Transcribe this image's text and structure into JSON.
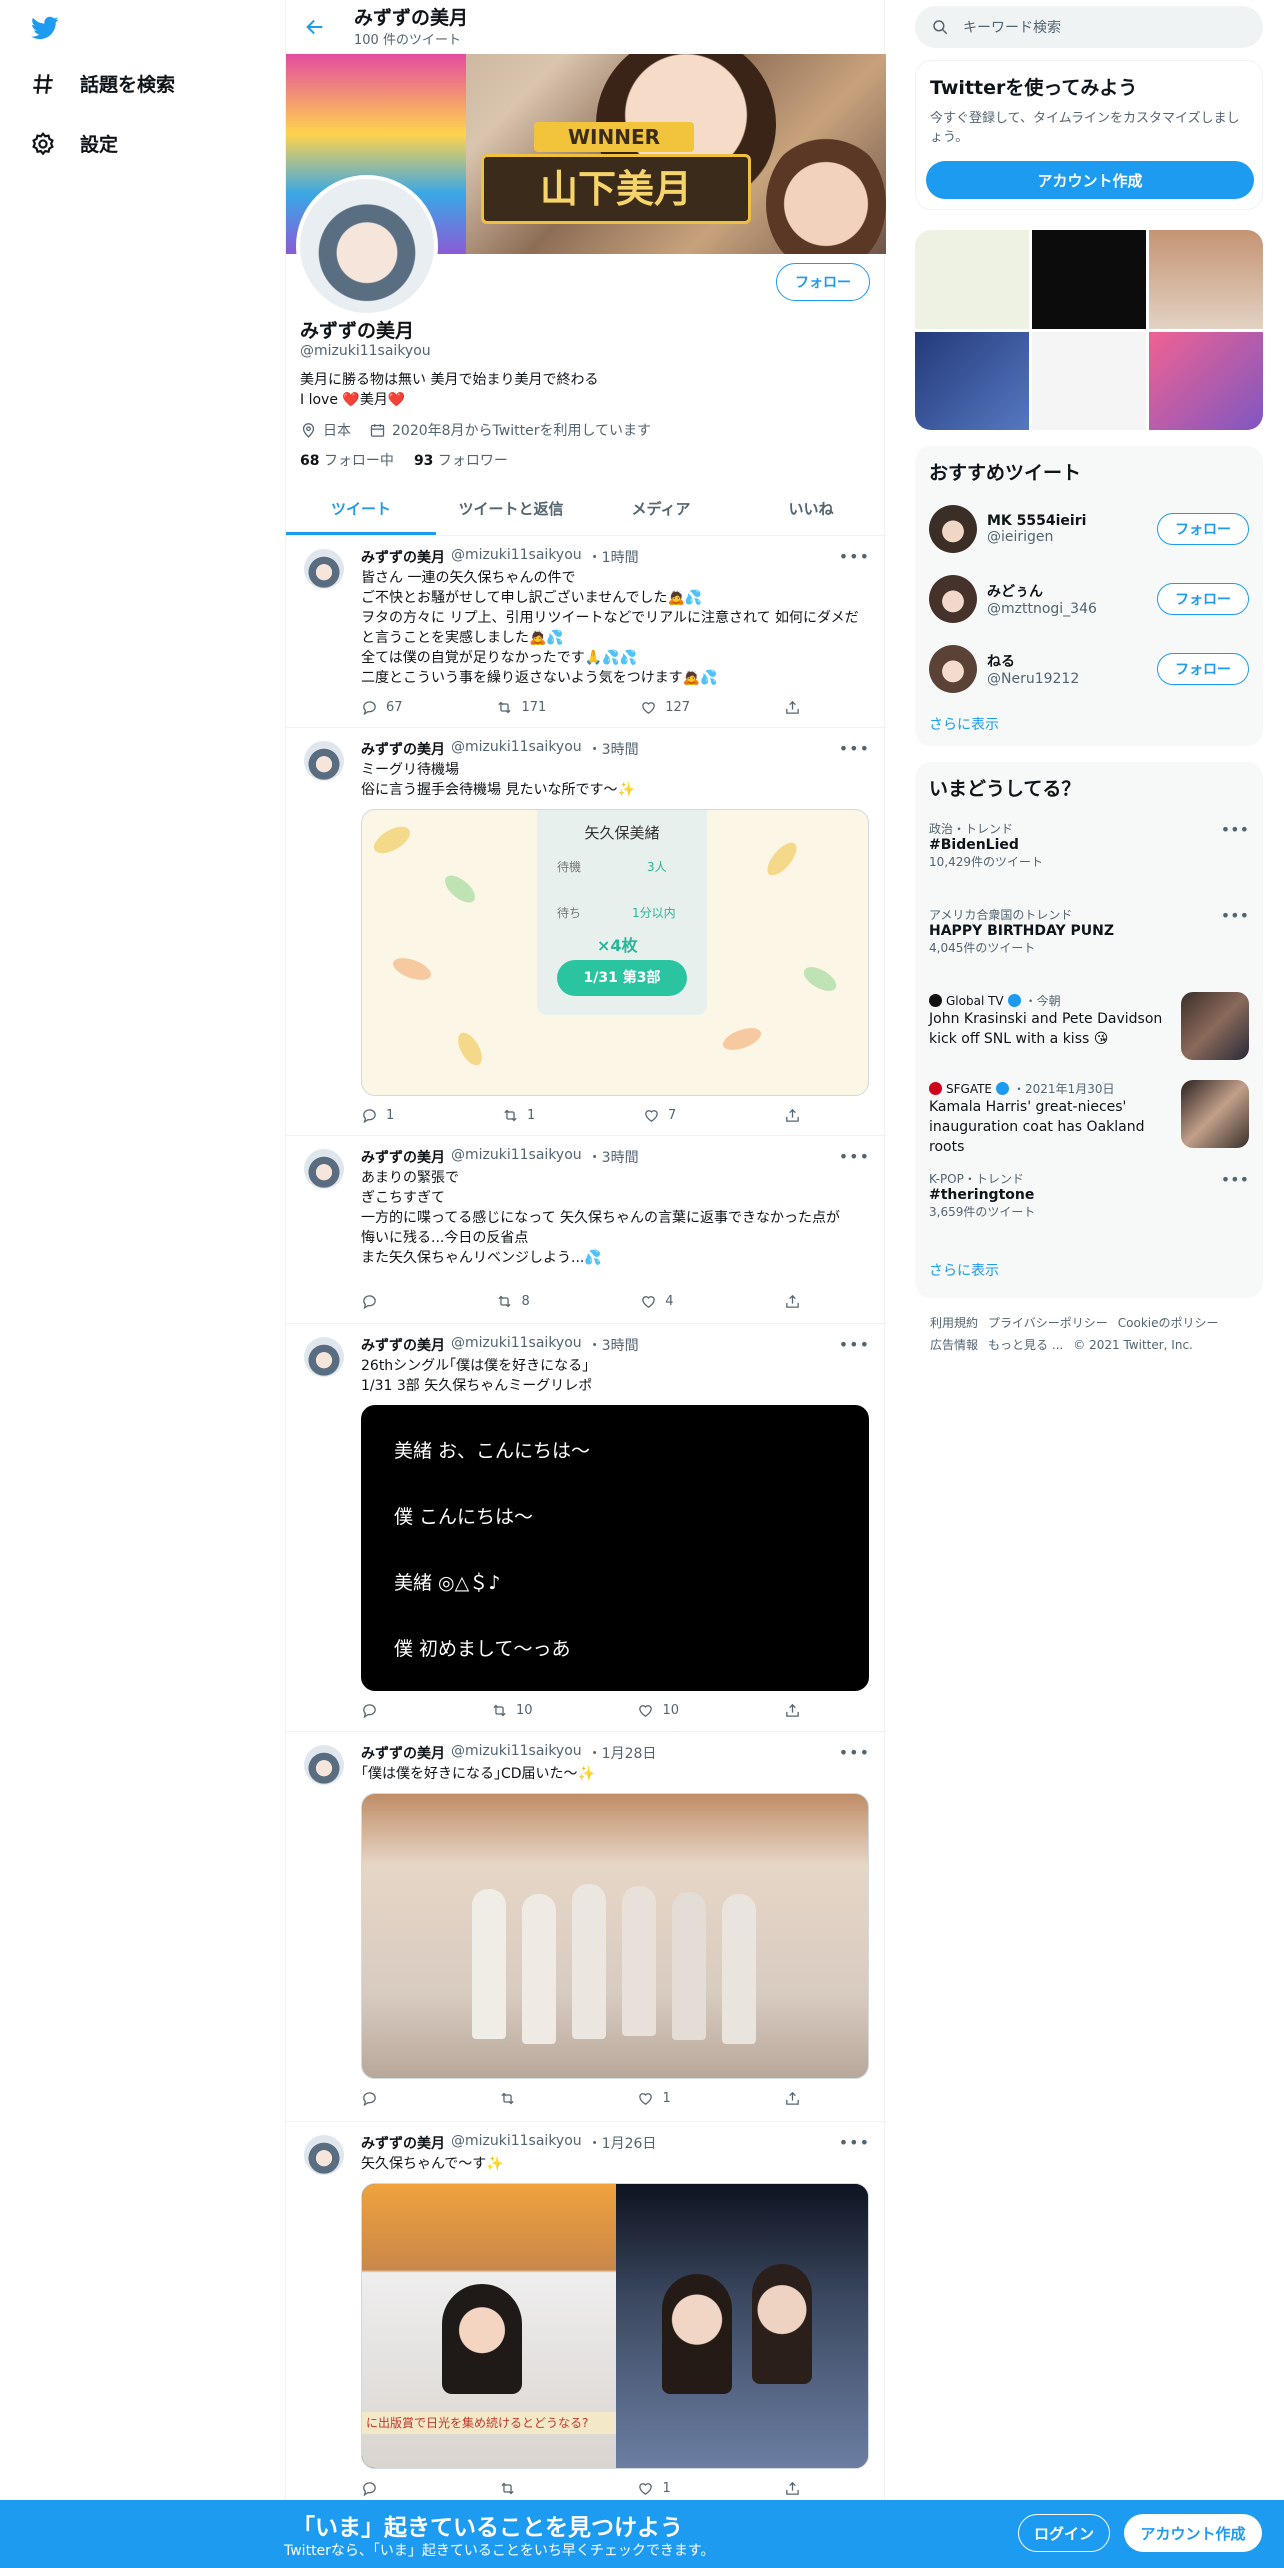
{
  "nav": {
    "explore_label": "話題を検索",
    "settings_label": "設定"
  },
  "topbar": {
    "title": "みずずの美月",
    "tweet_count": "100 件のツイート"
  },
  "banner": {
    "winner": "WINNER",
    "name_plate": "山下美月"
  },
  "profile": {
    "follow_label": "フォロー",
    "name": "みずずの美月",
    "handle": "@mizuki11saikyou",
    "bio_line1": "美月に勝る物は無い 美月で始まり美月で終わる",
    "bio_line2": "I love ❤️美月❤️",
    "location": "日本",
    "joined": "2020年8月からTwitterを利用しています",
    "following_count": "68",
    "following_label": "フォロー中",
    "followers_count": "93",
    "followers_label": "フォロワー"
  },
  "tabs": [
    "ツイート",
    "ツイートと返信",
    "メディア",
    "いいね"
  ],
  "tweets": [
    {
      "name": "みずずの美月",
      "handle": "@mizuki11saikyou",
      "time": "・1時間",
      "text": "皆さん 一連の矢久保ちゃんの件で\nご不快とお騒がせして申し訳ございませんでした🙇💦\nヲタの方々に リプ上、引用リツイートなどでリアルに注意されて 如何にダメだと言うことを実感しました🙇💦\n全ては僕の自覚が足りなかったです🙏💦💦\n二度とこういう事を繰り返さないよう気をつけます🙇💦",
      "reply": "67",
      "retweet": "171",
      "like": "127"
    },
    {
      "name": "みずずの美月",
      "handle": "@mizuki11saikyou",
      "time": "・3時間",
      "text": "ミーグリ待機場\n俗に言う握手会待機場 見たいな所です〜✨",
      "reply": "1",
      "retweet": "1",
      "like": "7",
      "card": {
        "title": "矢久保美緒",
        "wait_label": "待機",
        "wait_value": "3人",
        "time_label": "待ち",
        "time_value": "1分以内",
        "tickets": "×4枚",
        "session": "1/31 第3部"
      }
    },
    {
      "name": "みずずの美月",
      "handle": "@mizuki11saikyou",
      "time": "・3時間",
      "text": "あまりの緊張で\nぎこちすぎて\n一方的に喋ってる感じになって 矢久保ちゃんの言葉に返事できなかった点が\n悔いに残る...今日の反省点\nまた矢久保ちゃんリベンジしよう...💦",
      "reply": "",
      "retweet": "8",
      "like": "4"
    },
    {
      "name": "みずずの美月",
      "handle": "@mizuki11saikyou",
      "time": "・3時間",
      "text": "26thシングル｢僕は僕を好きになる｣\n1/31 3部 矢久保ちゃんミーグリレポ",
      "reply": "",
      "retweet": "10",
      "like": "10",
      "chat": [
        "美緒 お、こんにちは〜",
        "僕 こんにちは〜",
        "美緒 ◎△＄♪",
        "僕 初めまして〜っあ"
      ]
    },
    {
      "name": "みずずの美月",
      "handle": "@mizuki11saikyou",
      "time": "・1月28日",
      "text": "｢僕は僕を好きになる｣CD届いた〜✨",
      "reply": "",
      "retweet": "",
      "like": "1"
    },
    {
      "name": "みずずの美月",
      "handle": "@mizuki11saikyou",
      "time": "・1月26日",
      "text": "矢久保ちゃんで〜す✨",
      "reply": "",
      "retweet": "",
      "like": "1",
      "caption": "に出版賞で日光を集め続けるとどうなる?"
    }
  ],
  "right": {
    "search_placeholder": "キーワード検索",
    "signup_title": "Twitterを使ってみよう",
    "signup_desc": "今すぐ登録して、タイムラインをカスタマイズしましょう。",
    "signup_button": "アカウント作成",
    "rec_title": "おすすめツイート",
    "rec_users": [
      {
        "name": "MK 5554ieiri",
        "handle": "@ieirigen",
        "follow": "フォロー"
      },
      {
        "name": "みどぅん",
        "handle": "@mzttnogi_346",
        "follow": "フォロー"
      },
      {
        "name": "ねる",
        "handle": "@Neru19212",
        "follow": "フォロー"
      }
    ],
    "show_more": "さらに表示",
    "trends_title": "いまどうしてる？",
    "trends": [
      {
        "category": "政治・トレンド",
        "name": "#BidenLied",
        "count": "10,429件のツイート"
      },
      {
        "category": "アメリカ合衆国のトレンド",
        "name": "HAPPY BIRTHDAY PUNZ",
        "count": "4,045件のツイート"
      },
      {
        "source": "Global TV",
        "time": "・今朝",
        "name": "John Krasinski and Pete Davidson kick off SNL with a kiss 😘"
      },
      {
        "source": "SFGATE",
        "time": "・2021年1月30日",
        "name": "Kamala Harris' great-nieces' inauguration coat has Oakland roots"
      },
      {
        "category": "K-POP・トレンド",
        "name": "#theringtone",
        "count": "3,659件のツイート"
      }
    ],
    "trends_more": "さらに表示",
    "footer_line1": [
      "利用規約",
      "プライバシーポリシー",
      "Cookieのポリシー"
    ],
    "footer_line2": [
      "広告情報",
      "もっと見る ...",
      "© 2021 Twitter, Inc."
    ]
  },
  "bottom_bar": {
    "title": "「いま」起きていることを見つけよう",
    "subtitle": "Twitterなら、「いま」起きていることをいち早くチェックできます。",
    "login": "ログイン",
    "signup": "アカウント作成"
  },
  "colors": {
    "accent": "#1d9bf0",
    "like_red": "#f91880"
  }
}
